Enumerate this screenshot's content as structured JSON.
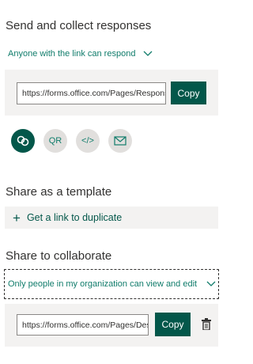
{
  "send": {
    "title": "Send and collect responses",
    "audience": "Anyone with the link can respond",
    "url": "https://forms.office.com/Pages/ResponsePage.aspx",
    "copy_label": "Copy",
    "icons": [
      {
        "name": "link-icon",
        "label": ""
      },
      {
        "name": "qr-icon",
        "label": "QR"
      },
      {
        "name": "embed-icon",
        "label": "</>"
      },
      {
        "name": "email-icon",
        "label": ""
      }
    ]
  },
  "template": {
    "title": "Share as a template",
    "link_label": "Get a link to duplicate",
    "plus": "+"
  },
  "collab": {
    "title": "Share to collaborate",
    "audience": "Only people in my organization can view and edit",
    "url": "https://forms.office.com/Pages/DesignPage.aspx",
    "copy_label": "Copy"
  },
  "colors": {
    "accent": "#03574a",
    "link": "#107c6b",
    "panel": "#f3f2f1"
  }
}
